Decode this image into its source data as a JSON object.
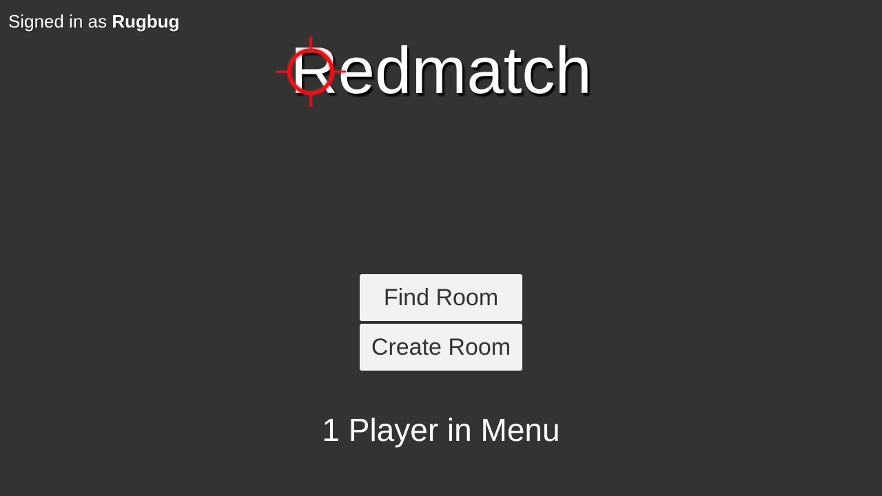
{
  "header": {
    "signed_in_prefix": "Signed in as",
    "username": "Rugbug"
  },
  "logo": {
    "title": "Redmatch",
    "crosshair_icon": "crosshair-icon",
    "crosshair_color": "#e0141e"
  },
  "menu": {
    "find_room_label": "Find Room",
    "create_room_label": "Create Room"
  },
  "status": {
    "player_count_text": "1 Player in Menu"
  },
  "colors": {
    "background": "#333333",
    "button_bg": "#f2f2f2",
    "button_text": "#333333",
    "text": "#ffffff"
  }
}
